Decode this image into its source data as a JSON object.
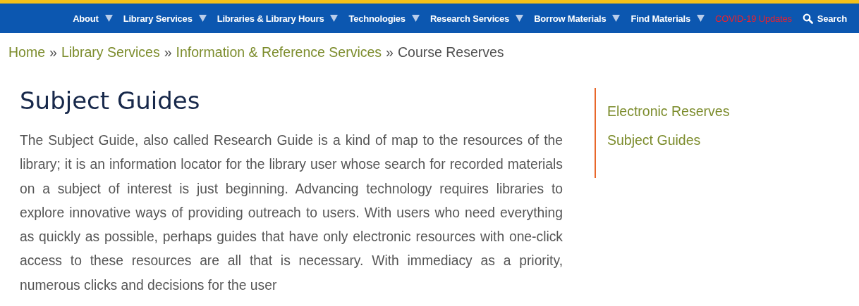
{
  "nav": {
    "items": [
      {
        "label": "About",
        "kind": "menu"
      },
      {
        "label": "Library Services",
        "kind": "menu"
      },
      {
        "label": "Libraries & Library Hours",
        "kind": "menu"
      },
      {
        "label": "Technologies",
        "kind": "menu"
      },
      {
        "label": "Research Services",
        "kind": "menu"
      },
      {
        "label": "Borrow Materials",
        "kind": "menu"
      },
      {
        "label": "Find Materials",
        "kind": "menu"
      },
      {
        "label": "COVID-19 Updates",
        "kind": "alert"
      },
      {
        "label": "Search",
        "kind": "search"
      }
    ]
  },
  "breadcrumb": [
    {
      "label": "Home",
      "kind": "link"
    },
    {
      "label": "»",
      "kind": "separator"
    },
    {
      "label": "Library Services",
      "kind": "link"
    },
    {
      "label": "»",
      "kind": "separator"
    },
    {
      "label": "Information & Reference Services",
      "kind": "link"
    },
    {
      "label": "»",
      "kind": "separator"
    },
    {
      "label": "Course Reserves",
      "kind": "current"
    }
  ],
  "article": {
    "title": "Subject Guides",
    "paragraph": "The Subject Guide, also called Research Guide is a kind of map to the resources of the library; it is an information locator for the library user whose search for recorded materials on a subject of interest is just beginning. Advancing technology requires libraries to explore innovative ways of providing outreach to users. With users who need everything as quickly as possible, perhaps guides that have only electronic resources with one-click access to these resources are all that is necessary. With immediacy as a priority, numerous clicks and decisions for the user"
  },
  "sidebar": {
    "links": [
      "Electronic Reserves",
      "Subject Guides"
    ]
  }
}
